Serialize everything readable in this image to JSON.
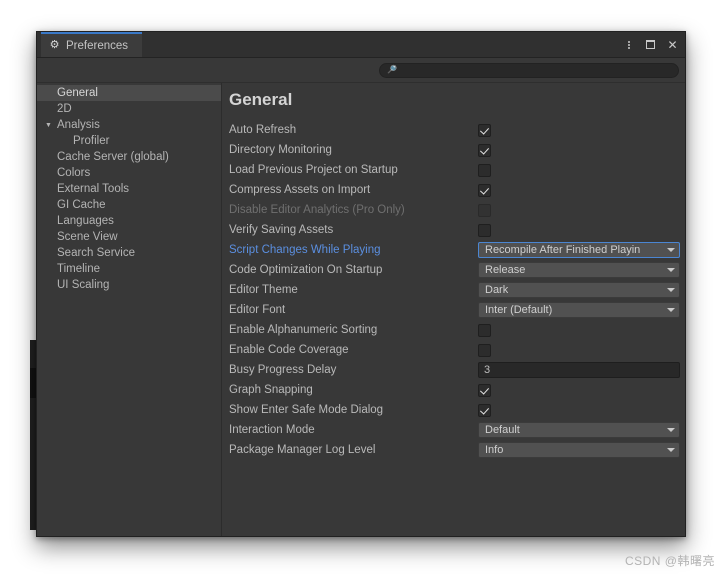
{
  "window": {
    "tab_label": "Preferences",
    "tab_icon": "gear-icon",
    "menu_icon": "kebab-menu-icon",
    "maximize_icon": "maximize-icon",
    "close_icon": "close-icon",
    "close_glyph": "✕",
    "accent_color": "#3a79c8"
  },
  "search": {
    "value": "",
    "placeholder": "",
    "icon": "search-icon"
  },
  "sidebar": {
    "items": [
      {
        "label": "General",
        "selected": true,
        "child": false,
        "arrow": ""
      },
      {
        "label": "2D",
        "selected": false,
        "child": false,
        "arrow": ""
      },
      {
        "label": "Analysis",
        "selected": false,
        "child": false,
        "arrow": "▼"
      },
      {
        "label": "Profiler",
        "selected": false,
        "child": true,
        "arrow": ""
      },
      {
        "label": "Cache Server (global)",
        "selected": false,
        "child": false,
        "arrow": ""
      },
      {
        "label": "Colors",
        "selected": false,
        "child": false,
        "arrow": ""
      },
      {
        "label": "External Tools",
        "selected": false,
        "child": false,
        "arrow": ""
      },
      {
        "label": "GI Cache",
        "selected": false,
        "child": false,
        "arrow": ""
      },
      {
        "label": "Languages",
        "selected": false,
        "child": false,
        "arrow": ""
      },
      {
        "label": "Scene View",
        "selected": false,
        "child": false,
        "arrow": ""
      },
      {
        "label": "Search Service",
        "selected": false,
        "child": false,
        "arrow": ""
      },
      {
        "label": "Timeline",
        "selected": false,
        "child": false,
        "arrow": ""
      },
      {
        "label": "UI Scaling",
        "selected": false,
        "child": false,
        "arrow": ""
      }
    ]
  },
  "main": {
    "title": "General",
    "settings": [
      {
        "label": "Auto Refresh",
        "type": "checkbox",
        "value": true,
        "state": "normal"
      },
      {
        "label": "Directory Monitoring",
        "type": "checkbox",
        "value": true,
        "state": "normal"
      },
      {
        "label": "Load Previous Project on Startup",
        "type": "checkbox",
        "value": false,
        "state": "normal"
      },
      {
        "label": "Compress Assets on Import",
        "type": "checkbox",
        "value": true,
        "state": "normal"
      },
      {
        "label": "Disable Editor Analytics (Pro Only)",
        "type": "checkbox",
        "value": false,
        "state": "disabled"
      },
      {
        "label": "Verify Saving Assets",
        "type": "checkbox",
        "value": false,
        "state": "normal"
      },
      {
        "label": "Script Changes While Playing",
        "type": "dropdown",
        "value": "Recompile After Finished Playin",
        "state": "highlight"
      },
      {
        "label": "Code Optimization On Startup",
        "type": "dropdown",
        "value": "Release",
        "state": "normal"
      },
      {
        "label": "Editor Theme",
        "type": "dropdown",
        "value": "Dark",
        "state": "normal"
      },
      {
        "label": "Editor Font",
        "type": "dropdown",
        "value": "Inter (Default)",
        "state": "normal"
      },
      {
        "label": "Enable Alphanumeric Sorting",
        "type": "checkbox",
        "value": false,
        "state": "normal"
      },
      {
        "label": "Enable Code Coverage",
        "type": "checkbox",
        "value": false,
        "state": "normal"
      },
      {
        "label": "Busy Progress Delay",
        "type": "number",
        "value": "3",
        "state": "normal"
      },
      {
        "label": "Graph Snapping",
        "type": "checkbox",
        "value": true,
        "state": "normal"
      },
      {
        "label": "Show Enter Safe Mode Dialog",
        "type": "checkbox",
        "value": true,
        "state": "normal"
      },
      {
        "label": "Interaction Mode",
        "type": "dropdown",
        "value": "Default",
        "state": "normal"
      },
      {
        "label": "Package Manager Log Level",
        "type": "dropdown",
        "value": "Info",
        "state": "normal"
      }
    ]
  },
  "watermark": {
    "text": "CSDN @韩曙亮"
  }
}
